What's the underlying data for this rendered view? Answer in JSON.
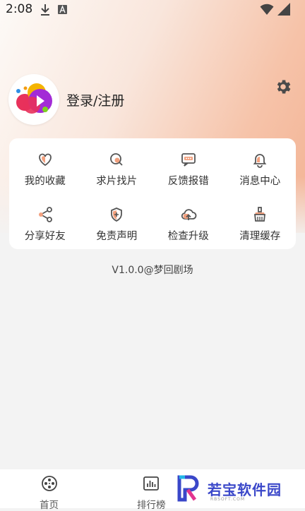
{
  "status_bar": {
    "time": "2:08",
    "icons": [
      "download-icon",
      "a-badge-icon",
      "wifi-icon",
      "battery-icon"
    ]
  },
  "profile": {
    "login_label": "登录/注册",
    "avatar_icon": "app-logo-icon",
    "settings_icon": "gear-icon"
  },
  "menu": {
    "items": [
      {
        "label": "我的收藏",
        "icon": "heart-icon"
      },
      {
        "label": "求片找片",
        "icon": "search-film-icon"
      },
      {
        "label": "反馈报错",
        "icon": "feedback-icon"
      },
      {
        "label": "消息中心",
        "icon": "bell-icon"
      },
      {
        "label": "分享好友",
        "icon": "share-icon"
      },
      {
        "label": "免责声明",
        "icon": "shield-icon"
      },
      {
        "label": "检查升级",
        "icon": "cloud-upload-icon"
      },
      {
        "label": "清理缓存",
        "icon": "broom-icon"
      }
    ]
  },
  "version_text": "V1.0.0@梦回剧场",
  "bottom_nav": {
    "tabs": [
      {
        "label": "首页",
        "icon": "film-reel-icon"
      },
      {
        "label": "排行榜",
        "icon": "bar-chart-icon"
      }
    ]
  },
  "watermark": {
    "text": "若宝软件园",
    "sub": "RBSOFT.COM"
  },
  "colors": {
    "accent": "#f2a07e",
    "icon_stroke": "#555555",
    "watermark_blue": "#3a47c9"
  }
}
